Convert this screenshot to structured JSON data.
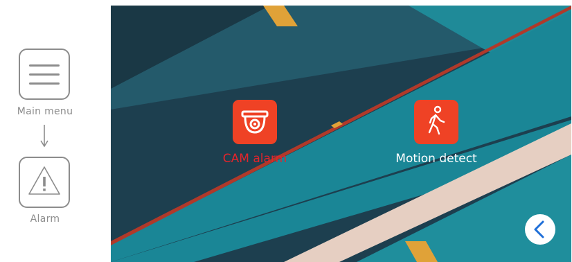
{
  "guide": {
    "step1_label": "Main menu",
    "step2_label": "Alarm",
    "icons": [
      "menu-icon",
      "arrow-down-icon",
      "warning-icon"
    ]
  },
  "screen": {
    "tiles": [
      {
        "label": "CAM alarm",
        "icon": "security-camera-icon",
        "state": "selected",
        "label_color": "#e4242b"
      },
      {
        "label": "Motion detect",
        "icon": "walking-person-icon",
        "state": "normal",
        "label_color": "#ffffff"
      }
    ],
    "back_icon": "chevron-left-icon"
  },
  "colors": {
    "tile_background": "#ef4225",
    "accent_blue": "#1f6fd8",
    "guide_gray": "#8c8c8c"
  }
}
